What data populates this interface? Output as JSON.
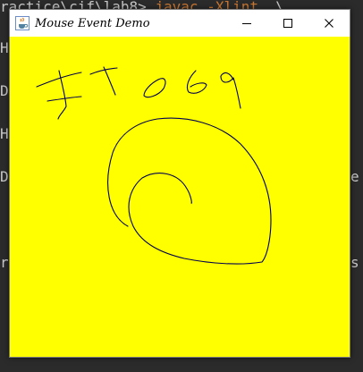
{
  "terminal": {
    "line1": "ractice\\cif\\lab8> ",
    "line1_cmd": "javac -Xlint",
    "line1_tail": " .\\",
    "line2": "H",
    "line3": "D",
    "line4": "H",
    "line5": "D",
    "line6": "r",
    "right1": "",
    "right2": "e",
    "right3": "s"
  },
  "window": {
    "title": "Mouse Event Demo",
    "minimize_icon": "minimize-icon",
    "maximize_icon": "maximize-icon",
    "close_icon": "close-icon",
    "canvas_color": "#ffff00",
    "stroke_color": "#000080"
  }
}
